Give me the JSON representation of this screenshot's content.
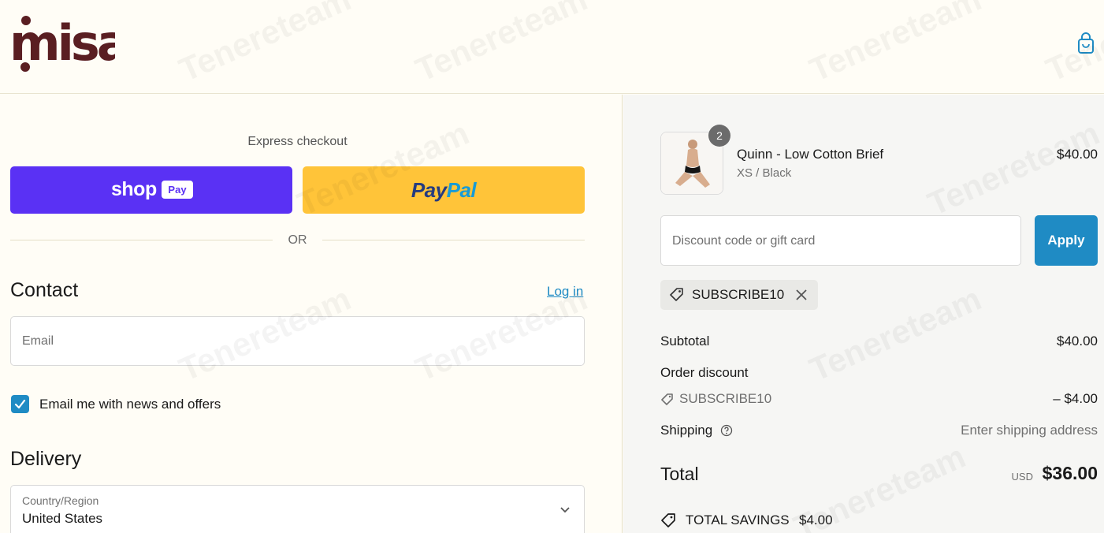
{
  "brand": {
    "logo_text": "misa",
    "logo_color": "#5a1e22"
  },
  "header": {
    "cart_icon": "shopping-bag-icon"
  },
  "express_checkout": {
    "title": "Express checkout",
    "shop_pay": {
      "word": "shop",
      "badge": "Pay",
      "color": "#5a31f4"
    },
    "paypal": {
      "part1": "Pay",
      "part2": "Pal",
      "color": "#ffc439"
    },
    "separator": "OR"
  },
  "contact": {
    "heading": "Contact",
    "login_link": "Log in",
    "email_placeholder": "Email",
    "email_value": "",
    "newsletter_label": "Email me with news and offers",
    "newsletter_checked": true
  },
  "delivery": {
    "heading": "Delivery",
    "country_label": "Country/Region",
    "country_value": "United States"
  },
  "order": {
    "item": {
      "name": "Quinn - Low Cotton Brief",
      "variant": "XS / Black",
      "price": "$40.00",
      "quantity": "2"
    },
    "discount_placeholder": "Discount code or gift card",
    "apply_label": "Apply",
    "applied_code": "SUBSCRIBE10",
    "subtotal_label": "Subtotal",
    "subtotal_value": "$40.00",
    "order_discount_label": "Order discount",
    "discount_code": "SUBSCRIBE10",
    "discount_value": "– $4.00",
    "shipping_label": "Shipping",
    "shipping_value": "Enter shipping address",
    "total_label": "Total",
    "total_currency": "USD",
    "total_value": "$36.00",
    "savings_label": "TOTAL SAVINGS",
    "savings_value": "$4.00"
  },
  "watermark": "Tenereteam",
  "colors": {
    "accent": "#1f8bc4",
    "background": "#fffdf6",
    "summary_bg": "#f6f6f4"
  }
}
